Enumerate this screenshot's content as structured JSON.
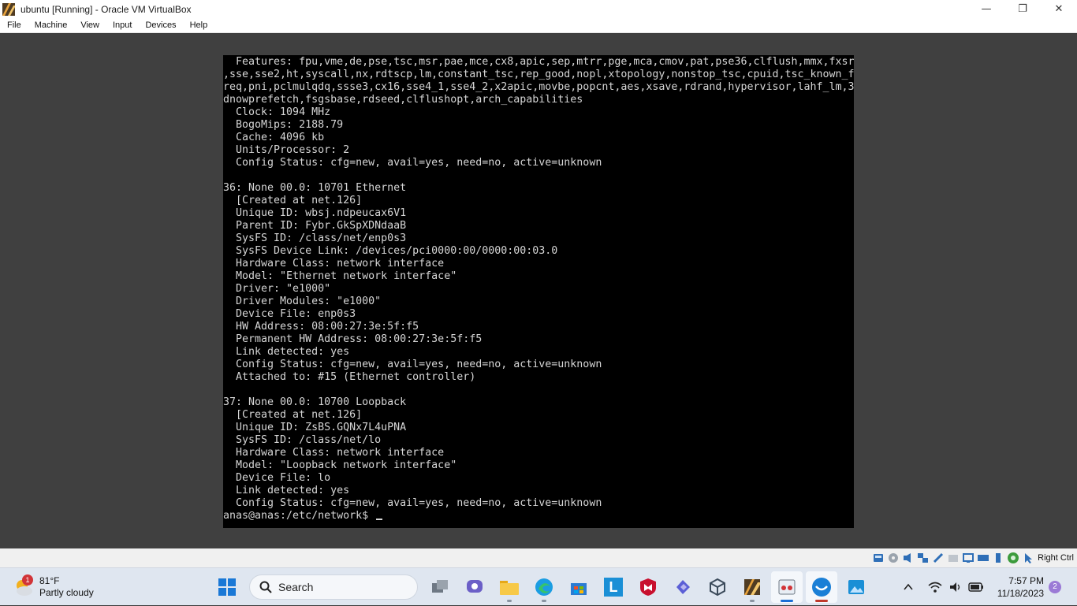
{
  "window": {
    "title": "ubuntu [Running] - Oracle VM VirtualBox",
    "controls": {
      "minimize": "—",
      "restore": "❐",
      "close": "✕"
    }
  },
  "menu": [
    "File",
    "Machine",
    "View",
    "Input",
    "Devices",
    "Help"
  ],
  "terminal": {
    "lines": [
      "  Features: fpu,vme,de,pse,tsc,msr,pae,mce,cx8,apic,sep,mtrr,pge,mca,cmov,pat,pse36,clflush,mmx,fxsr",
      ",sse,sse2,ht,syscall,nx,rdtscp,lm,constant_tsc,rep_good,nopl,xtopology,nonstop_tsc,cpuid,tsc_known_f",
      "req,pni,pclmulqdq,ssse3,cx16,sse4_1,sse4_2,x2apic,movbe,popcnt,aes,xsave,rdrand,hypervisor,lahf_lm,3",
      "dnowprefetch,fsgsbase,rdseed,clflushopt,arch_capabilities",
      "  Clock: 1094 MHz",
      "  BogoMips: 2188.79",
      "  Cache: 4096 kb",
      "  Units/Processor: 2",
      "  Config Status: cfg=new, avail=yes, need=no, active=unknown",
      "",
      "36: None 00.0: 10701 Ethernet",
      "  [Created at net.126]",
      "  Unique ID: wbsj.ndpeucax6V1",
      "  Parent ID: Fybr.GkSpXDNdaaB",
      "  SysFS ID: /class/net/enp0s3",
      "  SysFS Device Link: /devices/pci0000:00/0000:00:03.0",
      "  Hardware Class: network interface",
      "  Model: \"Ethernet network interface\"",
      "  Driver: \"e1000\"",
      "  Driver Modules: \"e1000\"",
      "  Device File: enp0s3",
      "  HW Address: 08:00:27:3e:5f:f5",
      "  Permanent HW Address: 08:00:27:3e:5f:f5",
      "  Link detected: yes",
      "  Config Status: cfg=new, avail=yes, need=no, active=unknown",
      "  Attached to: #15 (Ethernet controller)",
      "",
      "37: None 00.0: 10700 Loopback",
      "  [Created at net.126]",
      "  Unique ID: ZsBS.GQNx7L4uPNA",
      "  SysFS ID: /class/net/lo",
      "  Hardware Class: network interface",
      "  Model: \"Loopback network interface\"",
      "  Device File: lo",
      "  Link detected: yes",
      "  Config Status: cfg=new, avail=yes, need=no, active=unknown"
    ],
    "prompt": "anas@anas:/etc/network$ "
  },
  "statusbar": {
    "host_key": "Right Ctrl"
  },
  "taskbar": {
    "weather": {
      "temp": "81°F",
      "condition": "Partly cloudy",
      "badge": "1"
    },
    "search_label": "Search",
    "clock": {
      "time": "7:57 PM",
      "date": "11/18/2023"
    },
    "notifications": "2",
    "app_letter": "L"
  },
  "colors": {
    "terminal_bg": "#000000",
    "terminal_fg": "#d6d6d6",
    "taskbar": "#dfe6f0",
    "accent": "#1a6fd6"
  }
}
